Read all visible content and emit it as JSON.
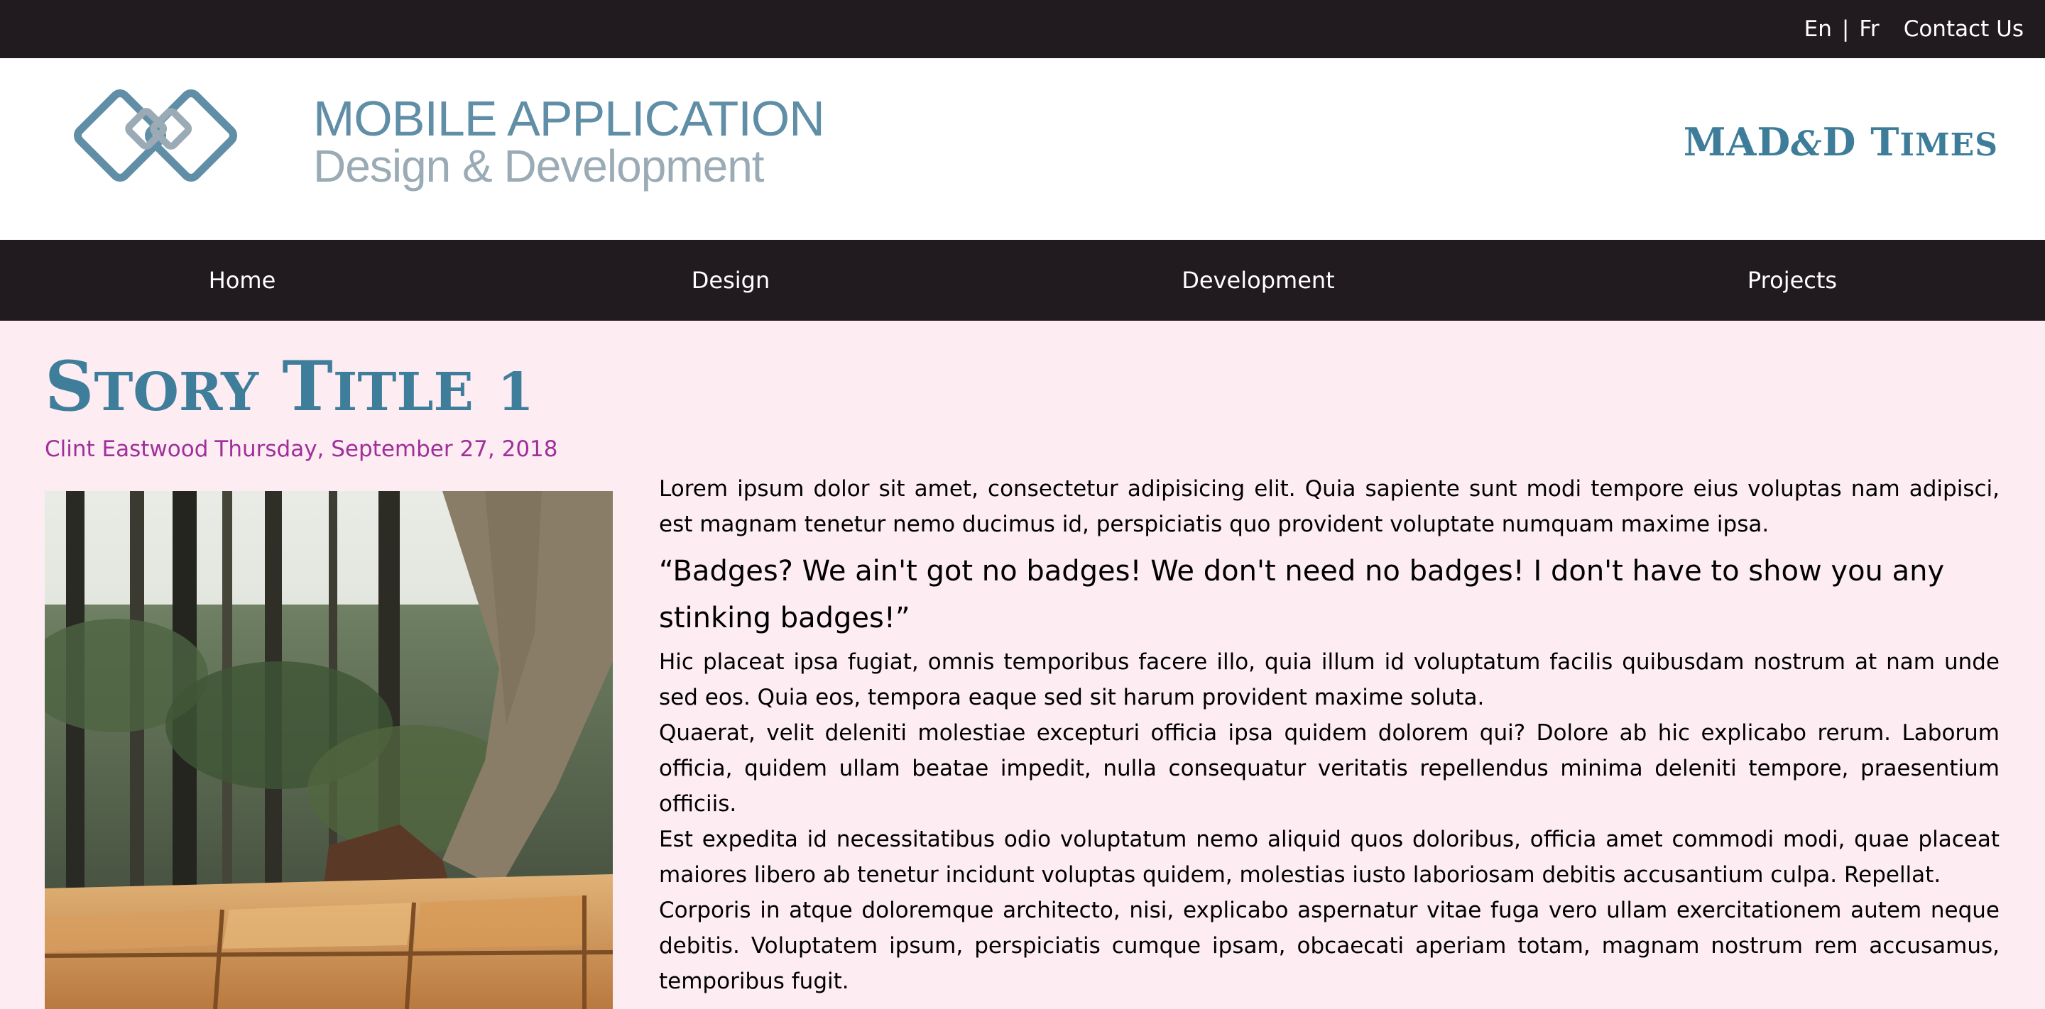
{
  "topbar": {
    "lang_en": "En",
    "lang_separator": "|",
    "lang_fr": "Fr",
    "contact_label": "Contact Us"
  },
  "header": {
    "logo_line1": "MOBILE APPLICATION",
    "logo_line2": "Design & Development",
    "brand_part1": "MAD",
    "brand_amp": "&",
    "brand_part2": "D T",
    "brand_part3": "IMES"
  },
  "nav": {
    "items": [
      {
        "label": "Home"
      },
      {
        "label": "Design"
      },
      {
        "label": "Development"
      },
      {
        "label": "Projects"
      }
    ]
  },
  "story": {
    "title_s": "S",
    "title_tory": "TORY",
    "title_t": "T",
    "title_itle": "ITLE",
    "title_num": "1",
    "author": "Clint Eastwood",
    "date": "Thursday, September 27, 2018",
    "paragraph1": "Lorem ipsum dolor sit amet, consectetur adipisicing elit. Quia sapiente sunt modi tempore eius voluptas nam adipisci, est magnam tenetur nemo ducimus id, perspiciatis quo provident voluptate numquam maxime ipsa.",
    "quote": "“Badges? We ain't got no badges! We don't need no badges! I don't have to show you any stinking badges!”",
    "paragraph2": "Hic placeat ipsa fugiat, omnis temporibus facere illo, quia illum id voluptatum facilis quibusdam nostrum at nam unde sed eos. Quia eos, tempora eaque sed sit harum provident maxime soluta.",
    "paragraph3": "Quaerat, velit deleniti molestiae excepturi officia ipsa quidem dolorem qui? Dolore ab hic explicabo rerum. Laborum officia, quidem ullam beatae impedit, nulla consequatur veritatis repellendus minima deleniti tempore, praesentium officiis.",
    "paragraph4": "Est expedita id necessitatibus odio voluptatum nemo aliquid quos doloribus, officia amet commodi modi, quae placeat maiores libero ab tenetur incidunt voluptas quidem, molestias iusto laboriosam debitis accusantium culpa. Repellat.",
    "paragraph5": "Corporis in atque doloremque architecto, nisi, explicabo aspernatur vitae fuga vero ullam exercitationem autem neque debitis. Voluptatem ipsum, perspiciatis cumque ipsam, obcaecati aperiam totam, magnam nostrum rem accusamus, temporibus fugit."
  },
  "colors": {
    "dark_bar": "#211a1f",
    "page_bg": "#fdecf2",
    "title_blue": "#3f7e9b",
    "byline_purple": "#a02f9b"
  },
  "icons": {
    "logo": "interlocking-diamonds-logo",
    "photo": "hiker-on-boardwalk-photo"
  }
}
